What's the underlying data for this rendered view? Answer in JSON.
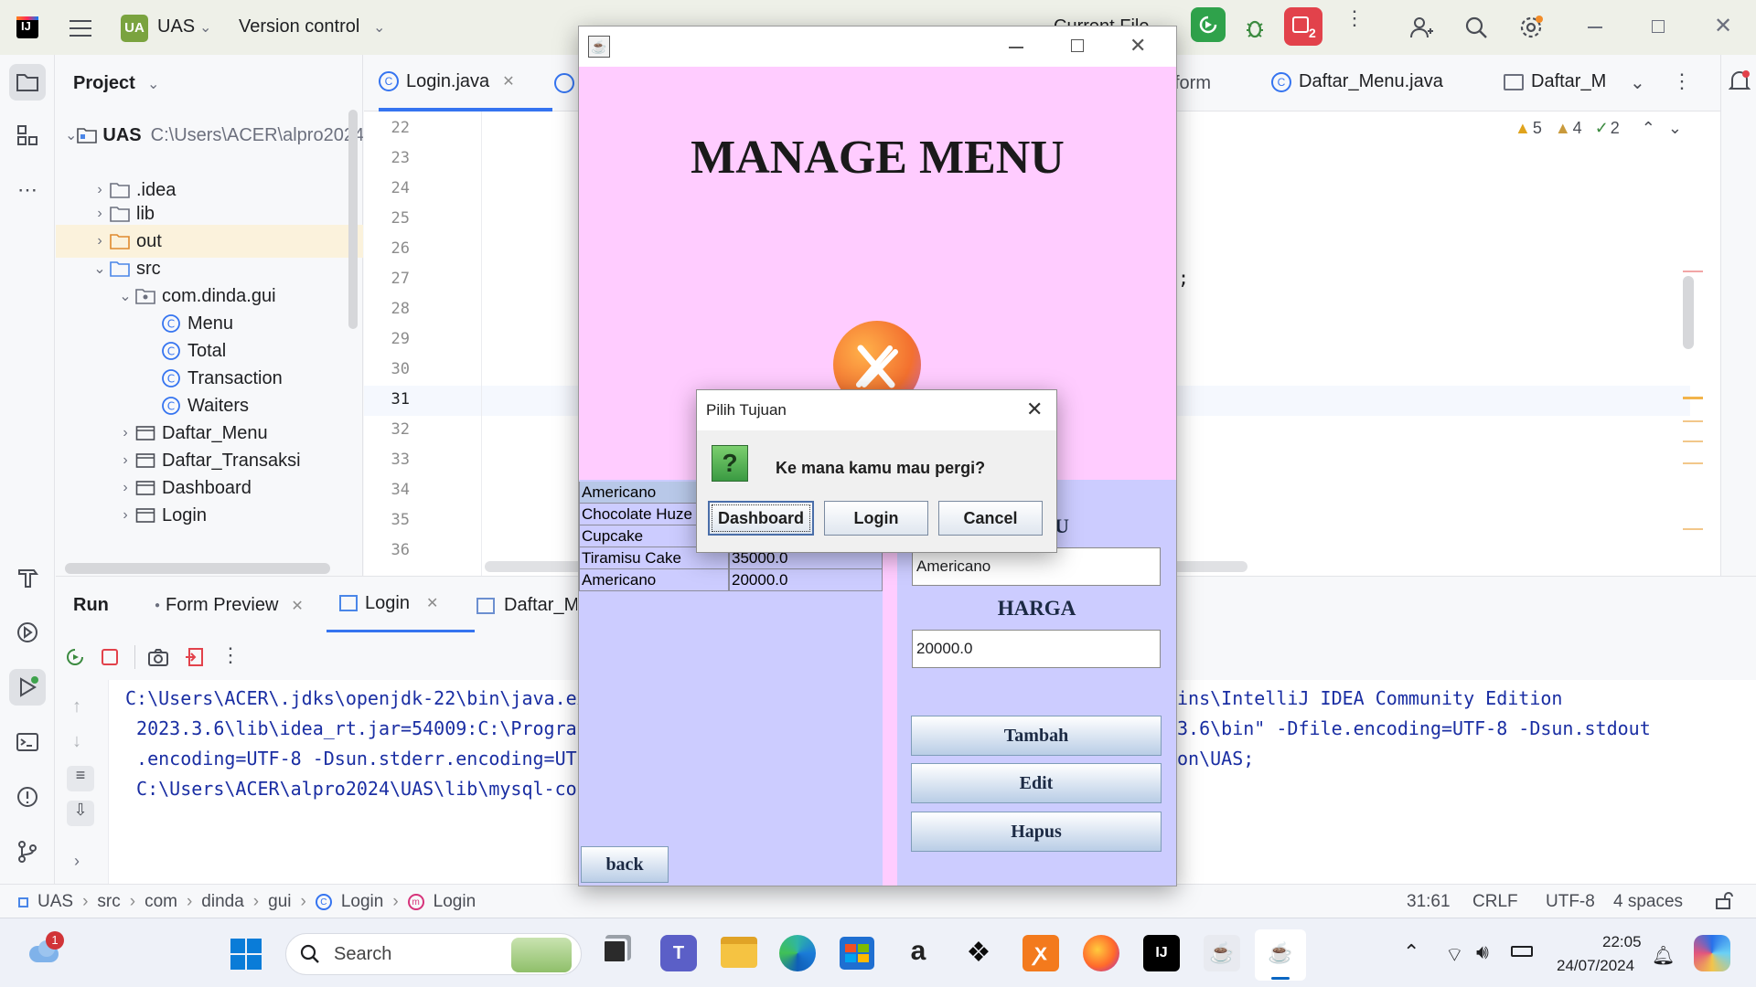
{
  "ide": {
    "project_badge": "UA",
    "project_name": "UAS",
    "vcs_label": "Version control",
    "run_config": "Current File",
    "notification_count": "2"
  },
  "project_panel": {
    "title": "Project",
    "root_name": "UAS",
    "root_path": "C:\\Users\\ACER\\alpro2024\\UAS",
    "items": [
      {
        "label": ".idea",
        "type": "folder"
      },
      {
        "label": "lib",
        "type": "folder"
      },
      {
        "label": "out",
        "type": "folder-orange"
      },
      {
        "label": "src",
        "type": "folder"
      },
      {
        "label": "com.dinda.gui",
        "type": "package"
      },
      {
        "label": "Menu",
        "type": "class"
      },
      {
        "label": "Total",
        "type": "class"
      },
      {
        "label": "Transaction",
        "type": "class"
      },
      {
        "label": "Waiters",
        "type": "class"
      },
      {
        "label": "Daftar_Menu",
        "type": "form"
      },
      {
        "label": "Daftar_Transaksi",
        "type": "form"
      },
      {
        "label": "Dashboard",
        "type": "form"
      },
      {
        "label": "Login",
        "type": "form"
      }
    ]
  },
  "editor": {
    "tabs": [
      {
        "label": "Login.java"
      },
      {
        "label": "form"
      },
      {
        "label": "Daftar_Menu.java"
      },
      {
        "label": "Daftar_M"
      }
    ],
    "line_numbers": [
      "22",
      "23",
      "24",
      "25",
      "26",
      "27",
      "28",
      "29",
      "30",
      "31",
      "32",
      "33",
      "34",
      "35",
      "36"
    ],
    "inspections": {
      "warnings": "5",
      "weak_warnings": "4",
      "ok": "2"
    }
  },
  "run_panel": {
    "title": "Run",
    "tabs": [
      {
        "label": "Form Preview"
      },
      {
        "label": "Login"
      },
      {
        "label": "Daftar_M"
      }
    ],
    "console_left": [
      "C:\\Users\\ACER\\.jdks\\openjdk-22\\bin\\java.ex",
      " 2023.3.6\\lib\\idea_rt.jar=54009:C:\\Progran",
      " .encoding=UTF-8 -Dsun.stderr.encoding=UTF",
      " C:\\Users\\ACER\\alpro2024\\UAS\\lib\\mysql-co"
    ],
    "console_right": [
      "ins\\IntelliJ IDEA Community Edition",
      "3.6\\bin\" -Dfile.encoding=UTF-8 -Dsun.stdout",
      "on\\UAS;"
    ]
  },
  "statusbar": {
    "crumbs": [
      "UAS",
      "src",
      "com",
      "dinda",
      "gui",
      "Login",
      "Login"
    ],
    "position": "31:61",
    "line_sep": "CRLF",
    "encoding": "UTF-8",
    "indent": "4 spaces"
  },
  "app": {
    "heading": "MANAGE MENU",
    "table_rows": [
      {
        "name": "Americano",
        "price": ""
      },
      {
        "name": "Chocolate Huze",
        "price": ""
      },
      {
        "name": "Cupcake",
        "price": ""
      },
      {
        "name": "Tiramisu Cake",
        "price": "35000.0"
      },
      {
        "name": "Americano",
        "price": "20000.0"
      }
    ],
    "name_value": "Americano",
    "price_label": "HARGA",
    "price_value": "20000.0",
    "btn_add": "Tambah",
    "btn_edit": "Edit",
    "btn_delete": "Hapus",
    "btn_back": "back",
    "partial_label": "U"
  },
  "dialog": {
    "title": "Pilih Tujuan",
    "message": "Ke mana kamu mau pergi?",
    "buttons": [
      "Dashboard",
      "Login",
      "Cancel"
    ]
  },
  "taskbar": {
    "search_placeholder": "Search",
    "weather_badge": "1",
    "time": "22:05",
    "date": "24/07/2024"
  },
  "colors": {
    "app_pink": "#ffccff",
    "app_lavender": "#ccccff",
    "ide_bg": "#f7f8fa",
    "console_text": "#1a2ea3"
  }
}
